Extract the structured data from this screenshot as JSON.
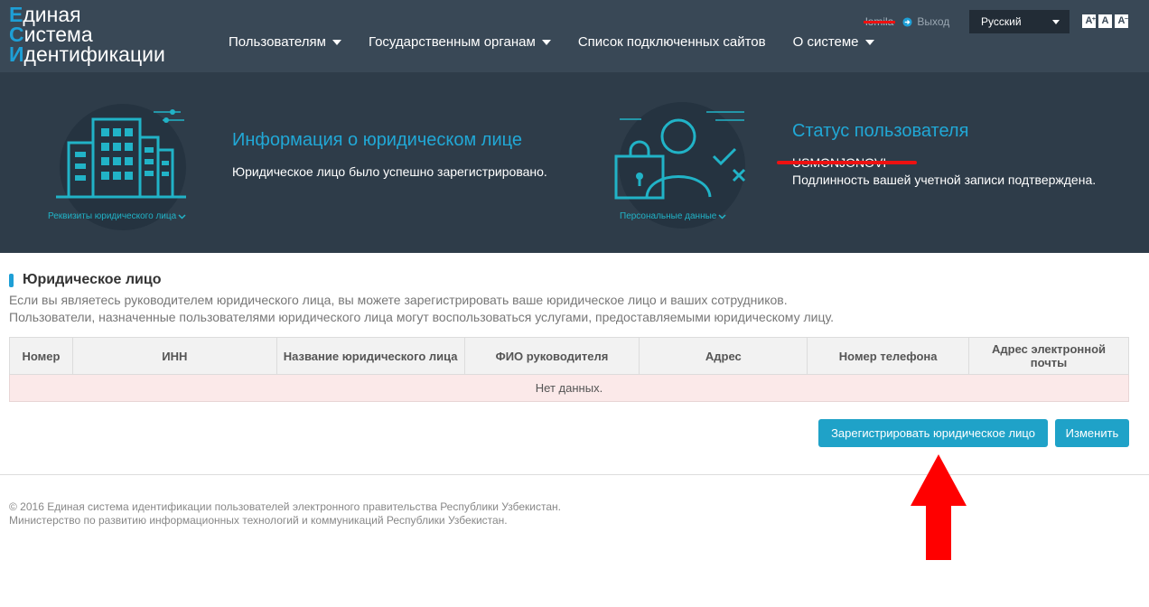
{
  "logo": {
    "lines": [
      {
        "cap": "Е",
        "rest": "диная"
      },
      {
        "cap": "С",
        "rest": "истема"
      },
      {
        "cap": "И",
        "rest": "дентификации"
      }
    ]
  },
  "nav": {
    "items": [
      {
        "label": "Пользователям",
        "dropdown": true
      },
      {
        "label": "Государственным органам",
        "dropdown": true
      },
      {
        "label": "Список подключенных сайтов",
        "dropdown": false
      },
      {
        "label": "О системе",
        "dropdown": true
      }
    ]
  },
  "user": {
    "username": "lomila",
    "logout_label": "Выход"
  },
  "language": {
    "selected": "Русский"
  },
  "font_controls": {
    "increase": "A",
    "increase_sup": "+",
    "normal": "A",
    "decrease": "A",
    "decrease_sup": "−"
  },
  "band": {
    "legal": {
      "icon_label": "Реквизиты юридического лица",
      "title": "Информация о юридическом лице",
      "text": "Юридическое лицо было успешно зарегистрировано."
    },
    "status": {
      "icon_label": "Персональные данные",
      "title": "Статус пользователя",
      "name": "USMONJONOVI",
      "text": "Подлинность вашей учетной записи подтверждена."
    }
  },
  "section": {
    "title": "Юридическое лицо",
    "desc_line1": "Если вы являетесь руководителем юридического лица, вы можете зарегистрировать ваше юридическое лицо и ваших сотрудников.",
    "desc_line2": "Пользователи, назначенные пользователями юридического лица могут воспользоваться услугами, предоставляемыми юридическому лицу."
  },
  "table": {
    "columns": [
      "Номер",
      "ИНН",
      "Название юридического лица",
      "ФИО руководителя",
      "Адрес",
      "Номер телефона",
      "Адрес электронной почты"
    ],
    "empty_text": "Нет данных."
  },
  "actions": {
    "register_label": "Зарегистрировать юридическое лицо",
    "edit_label": "Изменить"
  },
  "footer": {
    "line1": "© 2016 Единая система идентификации пользователей электронного правительства Республики Узбекистан.",
    "line2": "Министерство по развитию информационных технологий и коммуникаций Республики Узбекистан."
  },
  "colors": {
    "navbar": "#394856",
    "band": "#2e3c49",
    "accent": "#1fa2c8",
    "icon_teal": "#21b3c7",
    "annotation_red": "#ee1111"
  }
}
